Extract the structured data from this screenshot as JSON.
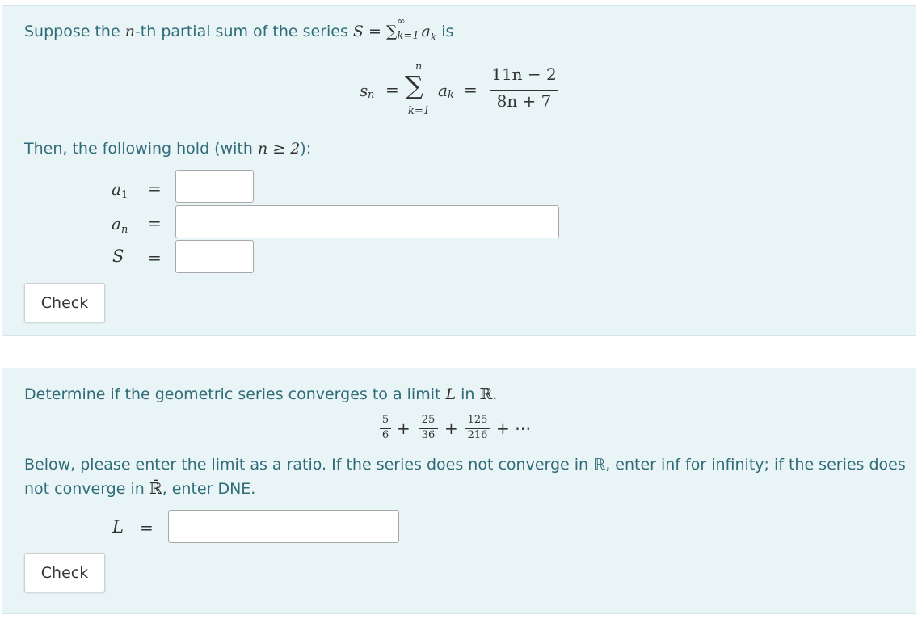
{
  "problem1": {
    "intro_before": "Suppose the ",
    "n_var": "n",
    "intro_mid": "-th partial sum of the series ",
    "S_var": "S",
    "eq_sign": "=",
    "sigma": "∑",
    "sum_sup": "∞",
    "sum_sub": "k=1",
    "a_k": "a",
    "k_sub": "k",
    "intro_end": " is",
    "display": {
      "s": "s",
      "n_sub": "n",
      "eq1": "=",
      "sigma": "∑",
      "upper": "n",
      "lower": "k=1",
      "a": "a",
      "k_sub": "k",
      "eq2": "=",
      "numerator": "11n − 2",
      "denominator": "8n + 7"
    },
    "then_before": "Then, the following hold (with ",
    "then_math": "n ≥ 2",
    "then_after": "):",
    "rows": [
      {
        "var": "a",
        "sub": "1",
        "eq": "=",
        "value": ""
      },
      {
        "var": "a",
        "sub": "n",
        "eq": "=",
        "value": ""
      },
      {
        "var": "S",
        "sub": "",
        "eq": "=",
        "value": ""
      }
    ],
    "check_label": "Check"
  },
  "problem2": {
    "intro_before": "Determine if the geometric series converges to a limit ",
    "L_var": "L",
    "in_word": " in ",
    "R": "ℝ",
    "period": ".",
    "series": {
      "t1_num": "5",
      "t1_den": "6",
      "plus": "+",
      "t2_num": "25",
      "t2_den": "36",
      "t3_num": "125",
      "t3_den": "216",
      "dots": "+ ⋯"
    },
    "below_line1": "Below, please enter the limit as a ratio. If the series does not converge in ℝ, enter inf for infinity; if the series does",
    "below_line2_before": "not converge in ",
    "Rbar": "ℝ̄",
    "below_line2_after": ", enter DNE.",
    "L_row": {
      "var": "L",
      "eq": "=",
      "value": ""
    },
    "check_label": "Check"
  }
}
